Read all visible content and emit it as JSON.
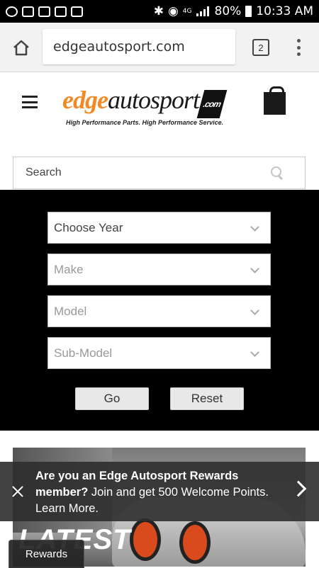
{
  "status_bar": {
    "battery": "80%",
    "time": "10:33 AM",
    "network": "4G"
  },
  "browser": {
    "url": "edgeautosport.com",
    "tab_count": "2"
  },
  "header": {
    "logo_edge": "edge",
    "logo_autosport": "autosport",
    "logo_com": ".com",
    "tagline": "High Performance Parts. High Performance Service."
  },
  "search": {
    "placeholder": "Search"
  },
  "vehicle_finder": {
    "year": "Choose Year",
    "make": "Make",
    "model": "Model",
    "submodel": "Sub-Model",
    "go_label": "Go",
    "reset_label": "Reset"
  },
  "banner": {
    "headline": "LATEST"
  },
  "rewards_toast": {
    "question": "Are you an Edge Autosport Rewards member?",
    "rest": " Join and get 500 Welcome Points. Learn More."
  },
  "rewards_tab": {
    "label": "Rewards"
  },
  "colors": {
    "brand_orange": "#f08a24",
    "finder_bg": "#000000"
  }
}
